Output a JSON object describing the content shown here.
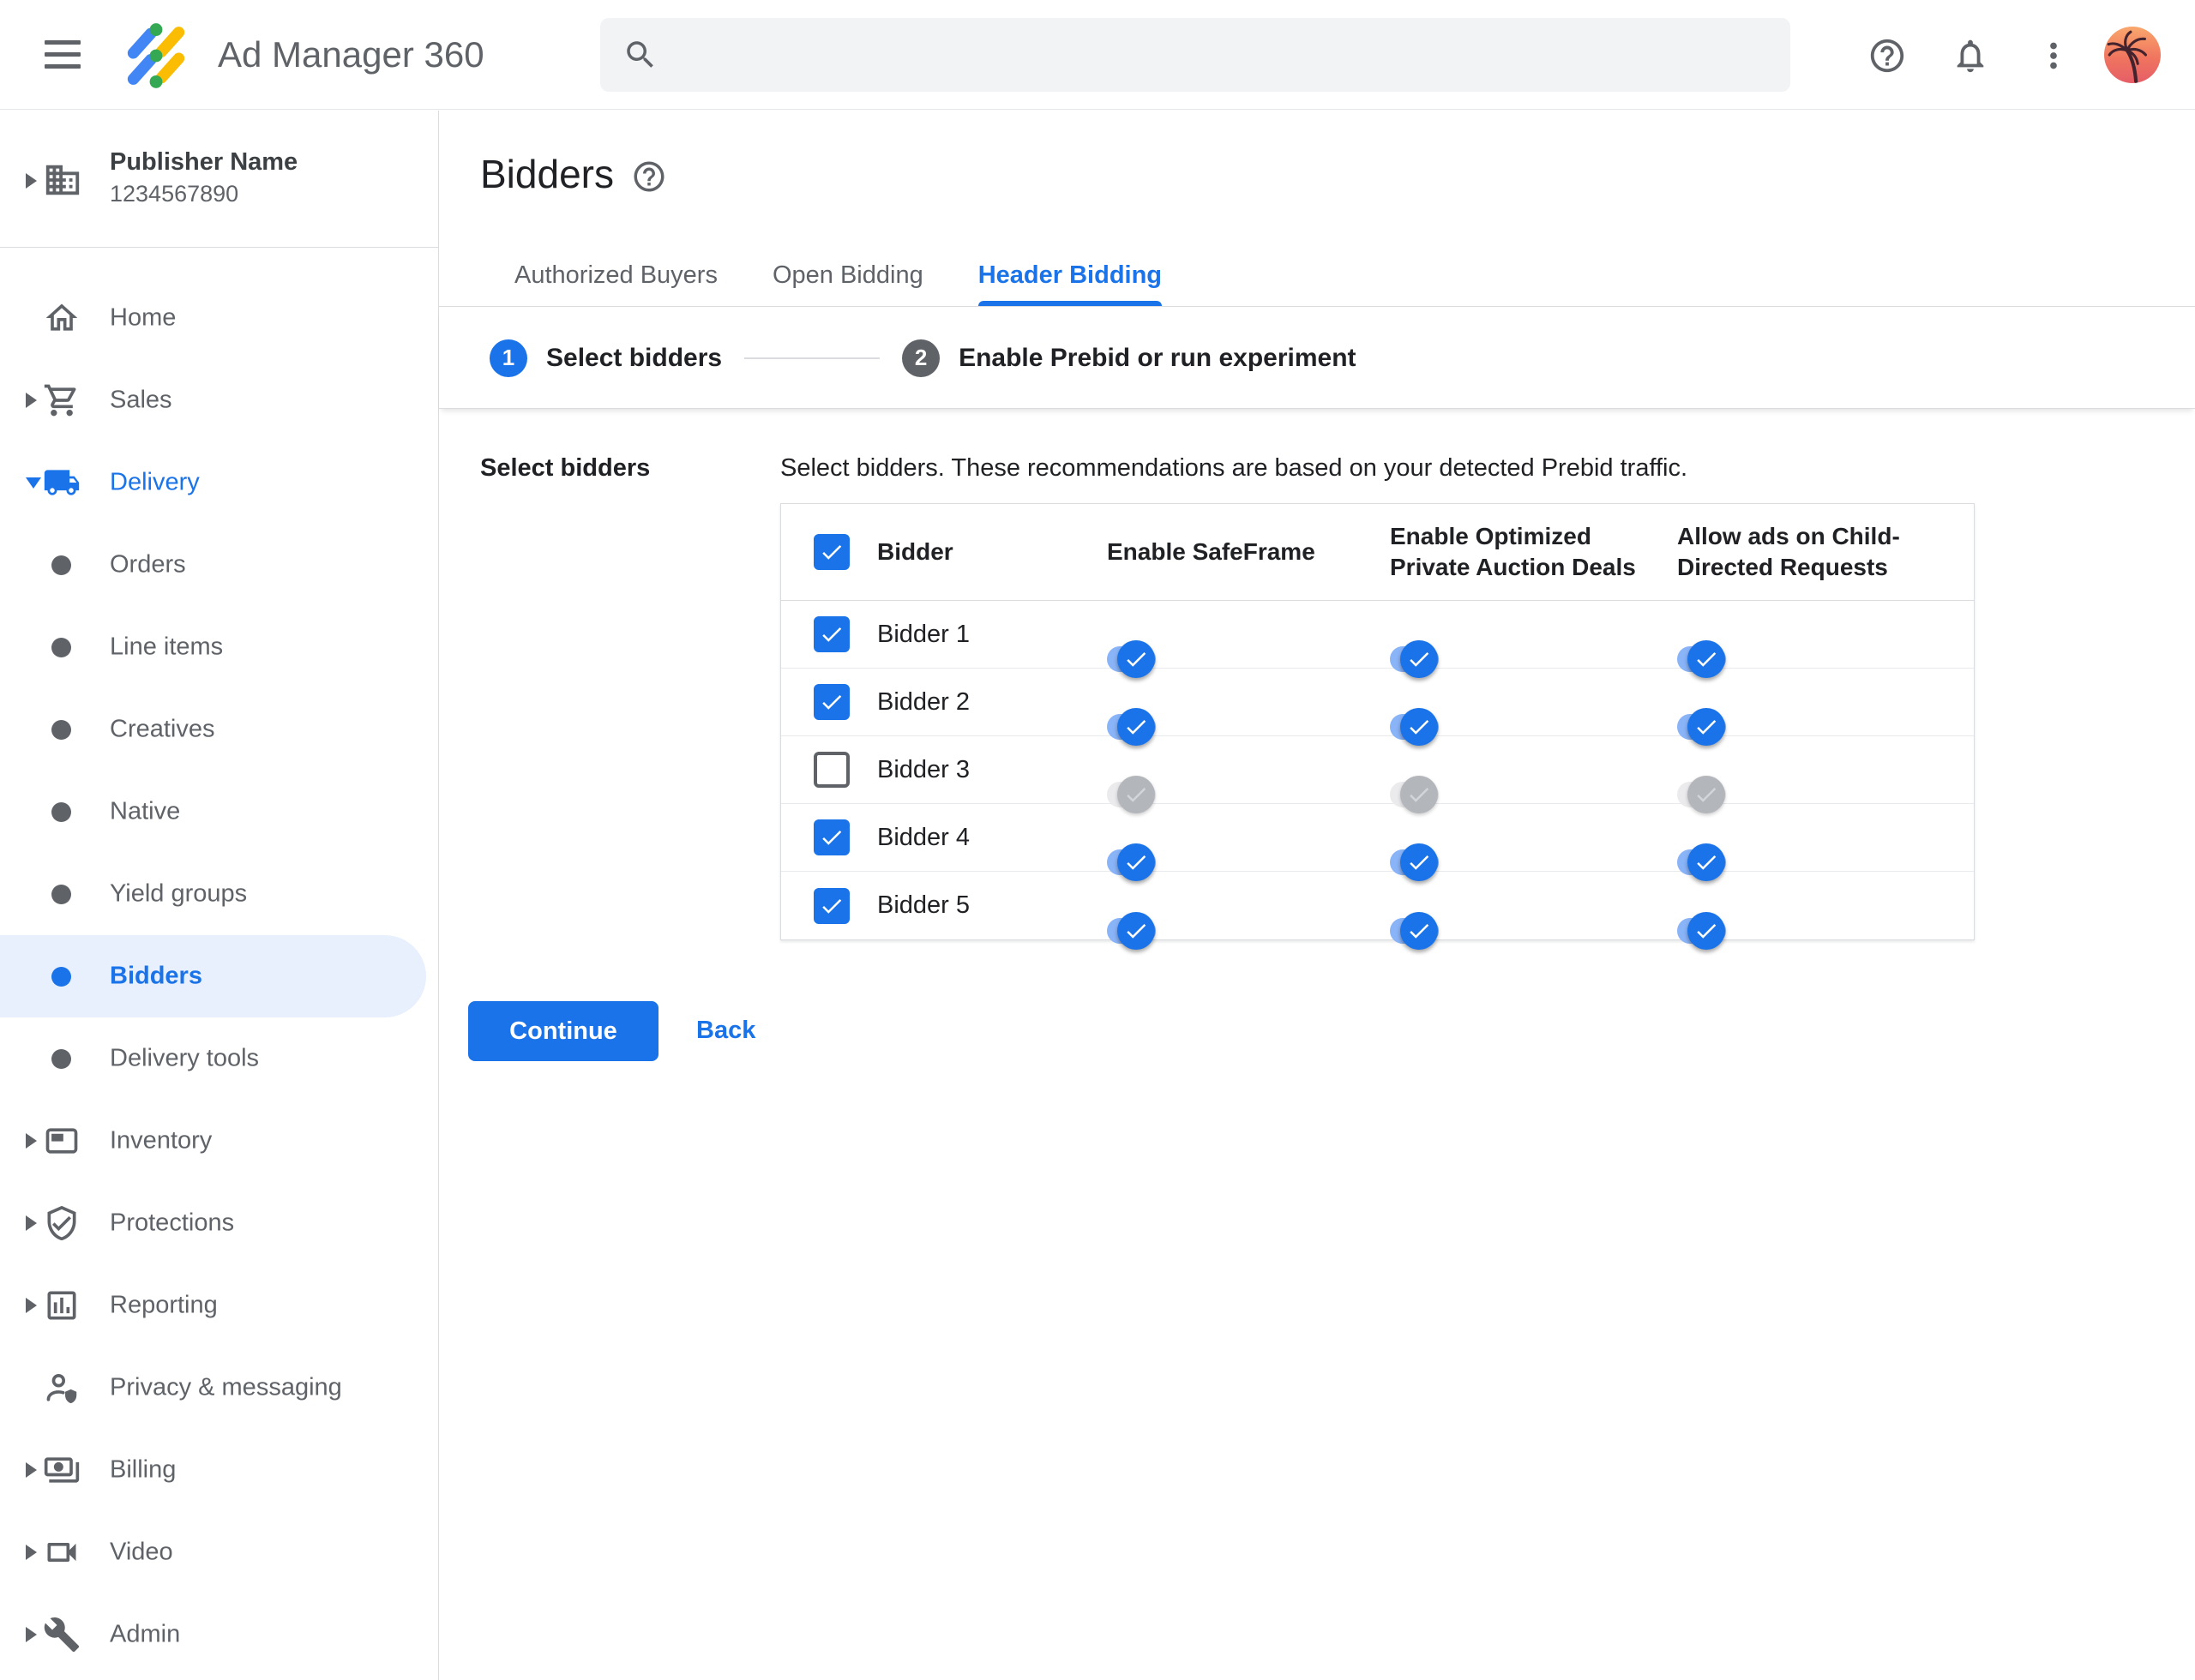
{
  "topbar": {
    "app_name": "Ad Manager 360"
  },
  "account": {
    "publisher_name": "Publisher Name",
    "publisher_code": "1234567890"
  },
  "sidebar": {
    "items": [
      {
        "label": "Home"
      },
      {
        "label": "Sales"
      },
      {
        "label": "Delivery",
        "expanded": true
      },
      {
        "label": "Orders"
      },
      {
        "label": "Line items"
      },
      {
        "label": "Creatives"
      },
      {
        "label": "Native"
      },
      {
        "label": "Yield groups"
      },
      {
        "label": "Bidders",
        "selected": true
      },
      {
        "label": "Delivery tools"
      },
      {
        "label": "Inventory"
      },
      {
        "label": "Protections"
      },
      {
        "label": "Reporting"
      },
      {
        "label": "Privacy & messaging"
      },
      {
        "label": "Billing"
      },
      {
        "label": "Video"
      },
      {
        "label": "Admin"
      }
    ]
  },
  "page": {
    "title": "Bidders"
  },
  "tabs": [
    {
      "label": "Authorized Buyers",
      "active": false
    },
    {
      "label": "Open Bidding",
      "active": false
    },
    {
      "label": "Header Bidding",
      "active": true
    }
  ],
  "stepper": {
    "steps": [
      {
        "number": "1",
        "label": "Select bidders",
        "active": true
      },
      {
        "number": "2",
        "label": "Enable Prebid or run experiment",
        "active": false
      }
    ]
  },
  "form": {
    "section_label": "Select bidders",
    "description": "Select bidders. These recommendations are based on your detected Prebid traffic."
  },
  "table": {
    "header_checkbox_checked": true,
    "columns": [
      "Bidder",
      "Enable SafeFrame",
      "Enable Optimized Private Auction Deals",
      "Allow ads on Child-Directed Requests"
    ],
    "rows": [
      {
        "name": "Bidder 1",
        "checked": true,
        "enable_safeframe": true,
        "enable_optimized_private_auction_deals": true,
        "allow_ads_child_directed": true
      },
      {
        "name": "Bidder 2",
        "checked": true,
        "enable_safeframe": true,
        "enable_optimized_private_auction_deals": true,
        "allow_ads_child_directed": true
      },
      {
        "name": "Bidder 3",
        "checked": false,
        "enable_safeframe": false,
        "enable_optimized_private_auction_deals": false,
        "allow_ads_child_directed": false
      },
      {
        "name": "Bidder 4",
        "checked": true,
        "enable_safeframe": true,
        "enable_optimized_private_auction_deals": true,
        "allow_ads_child_directed": true
      },
      {
        "name": "Bidder 5",
        "checked": true,
        "enable_safeframe": true,
        "enable_optimized_private_auction_deals": true,
        "allow_ads_child_directed": true
      }
    ]
  },
  "actions": {
    "continue_label": "Continue",
    "back_label": "Back"
  },
  "icons": {
    "menu-icon": "hamburger",
    "search-icon": "magnifier",
    "help-icon": "question-circle",
    "notifications-icon": "bell",
    "more-icon": "vertical-dots",
    "avatar": "palm-tree-photo",
    "publisher-icon": "building",
    "home-icon": "house",
    "sales-icon": "shopping-cart",
    "delivery-icon": "truck",
    "bullet-icon": "dot",
    "inventory-icon": "ad-unit",
    "protections-icon": "shield-check",
    "reporting-icon": "bar-chart",
    "privacy-icon": "person-shield",
    "billing-icon": "banknote",
    "video-icon": "video-camera",
    "admin-icon": "wrench",
    "title-help-icon": "question-circle",
    "checkbox-icon": "check",
    "toggle-icon": "check"
  },
  "colors": {
    "accent": "#1a73e8",
    "selected_nav_bg": "#e8f0fe",
    "toggle_on_track": "#8ab4f8",
    "toggle_on_thumb": "#1a73e8",
    "toggle_off_track": "#ebebed",
    "toggle_off_thumb": "#b3b6ba",
    "border": "#dadce0",
    "text_primary": "#202124",
    "text_secondary": "#5f6368",
    "logo_blue": "#4285f4",
    "logo_yellow": "#fbbc04",
    "logo_green": "#34a853",
    "search_bg": "#f1f3f4"
  }
}
